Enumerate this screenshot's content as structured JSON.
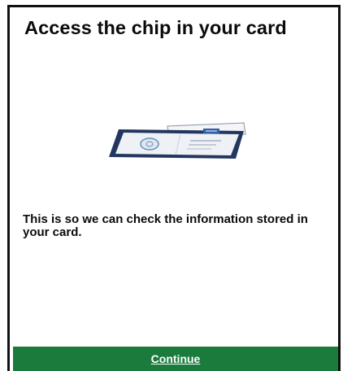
{
  "screen": {
    "title": "Access the chip in your card",
    "body": "This is so we can check the information stored in your card.",
    "illustration_icon": "phone-reading-card-icon"
  },
  "footer": {
    "continue_label": "Continue"
  },
  "colors": {
    "accent_green": "#1a7b3d",
    "phone_navy": "#23365f",
    "text": "#0b0b0b"
  }
}
